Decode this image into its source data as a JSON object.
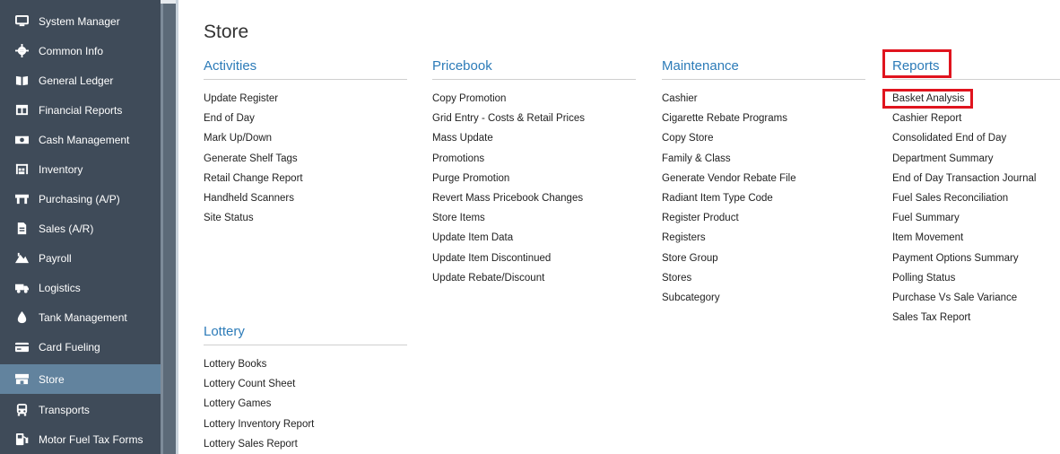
{
  "sidebar": {
    "items": [
      {
        "label": "System Manager",
        "icon": "monitor-icon"
      },
      {
        "label": "Common Info",
        "icon": "gear-icon"
      },
      {
        "label": "General Ledger",
        "icon": "book-icon"
      },
      {
        "label": "Financial Reports",
        "icon": "table-icon"
      },
      {
        "label": "Cash Management",
        "icon": "cash-icon"
      },
      {
        "label": "Inventory",
        "icon": "warehouse-icon"
      },
      {
        "label": "Purchasing (A/P)",
        "icon": "counter-icon"
      },
      {
        "label": "Sales (A/R)",
        "icon": "document-icon"
      },
      {
        "label": "Payroll",
        "icon": "payroll-icon"
      },
      {
        "label": "Logistics",
        "icon": "truck-icon"
      },
      {
        "label": "Tank Management",
        "icon": "drop-icon"
      },
      {
        "label": "Card Fueling",
        "icon": "card-icon"
      },
      {
        "label": "Store",
        "icon": "store-icon",
        "active": true
      },
      {
        "label": "Transports",
        "icon": "bus-icon"
      },
      {
        "label": "Motor Fuel Tax Forms",
        "icon": "fuel-pump-icon"
      }
    ]
  },
  "page": {
    "title": "Store"
  },
  "activities": {
    "heading": "Activities",
    "links": [
      "Update Register",
      "End of Day",
      "Mark Up/Down",
      "Generate Shelf Tags",
      "Retail Change Report",
      "Handheld Scanners",
      "Site Status"
    ]
  },
  "pricebook": {
    "heading": "Pricebook",
    "links": [
      "Copy Promotion",
      "Grid Entry - Costs & Retail Prices",
      "Mass Update",
      "Promotions",
      "Purge Promotion",
      "Revert Mass Pricebook Changes",
      "Store Items",
      "Update Item Data",
      "Update Item Discontinued",
      "Update Rebate/Discount"
    ]
  },
  "maintenance": {
    "heading": "Maintenance",
    "links": [
      "Cashier",
      "Cigarette Rebate Programs",
      "Copy Store",
      "Family & Class",
      "Generate Vendor Rebate File",
      "Radiant Item Type Code",
      "Register Product",
      "Registers",
      "Store Group",
      "Stores",
      "Subcategory"
    ]
  },
  "reports": {
    "heading": "Reports",
    "links": [
      "Basket Analysis",
      "Cashier Report",
      "Consolidated End of Day",
      "Department Summary",
      "End of Day Transaction Journal",
      "Fuel Sales Reconciliation",
      "Fuel Summary",
      "Item Movement",
      "Payment Options Summary",
      "Polling Status",
      "Purchase Vs Sale Variance",
      "Sales Tax Report"
    ]
  },
  "lottery": {
    "heading": "Lottery",
    "links": [
      "Lottery Books",
      "Lottery Count Sheet",
      "Lottery Games",
      "Lottery Inventory Report",
      "Lottery Sales Report"
    ]
  },
  "colors": {
    "sidebar_bg": "#3f4b59",
    "sidebar_active": "#62839e",
    "heading_blue": "#2c7bb8",
    "highlight_red": "#e0141e"
  }
}
